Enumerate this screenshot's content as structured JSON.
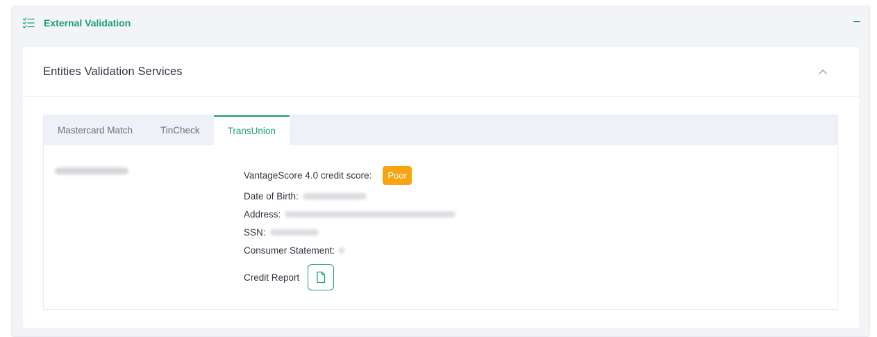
{
  "section": {
    "title": "External Validation",
    "icon": "checklist-icon",
    "collapse_icon": "minus-icon",
    "accent_color": "#1a9e78"
  },
  "card": {
    "title": "Entities Validation Services",
    "toggle_icon": "chevron-up-icon"
  },
  "tabs": [
    {
      "label": "Mastercard Match",
      "active": false
    },
    {
      "label": "TinCheck",
      "active": false
    },
    {
      "label": "TransUnion",
      "active": true
    }
  ],
  "transunion": {
    "score_label": "VantageScore 4.0 credit score:",
    "score_badge": "Poor",
    "score_badge_color": "#f7a413",
    "dob_label": "Date of Birth:",
    "address_label": "Address:",
    "ssn_label": "SSN:",
    "statement_label": "Consumer Statement:",
    "report_label": "Credit Report",
    "report_icon": "document-icon"
  }
}
